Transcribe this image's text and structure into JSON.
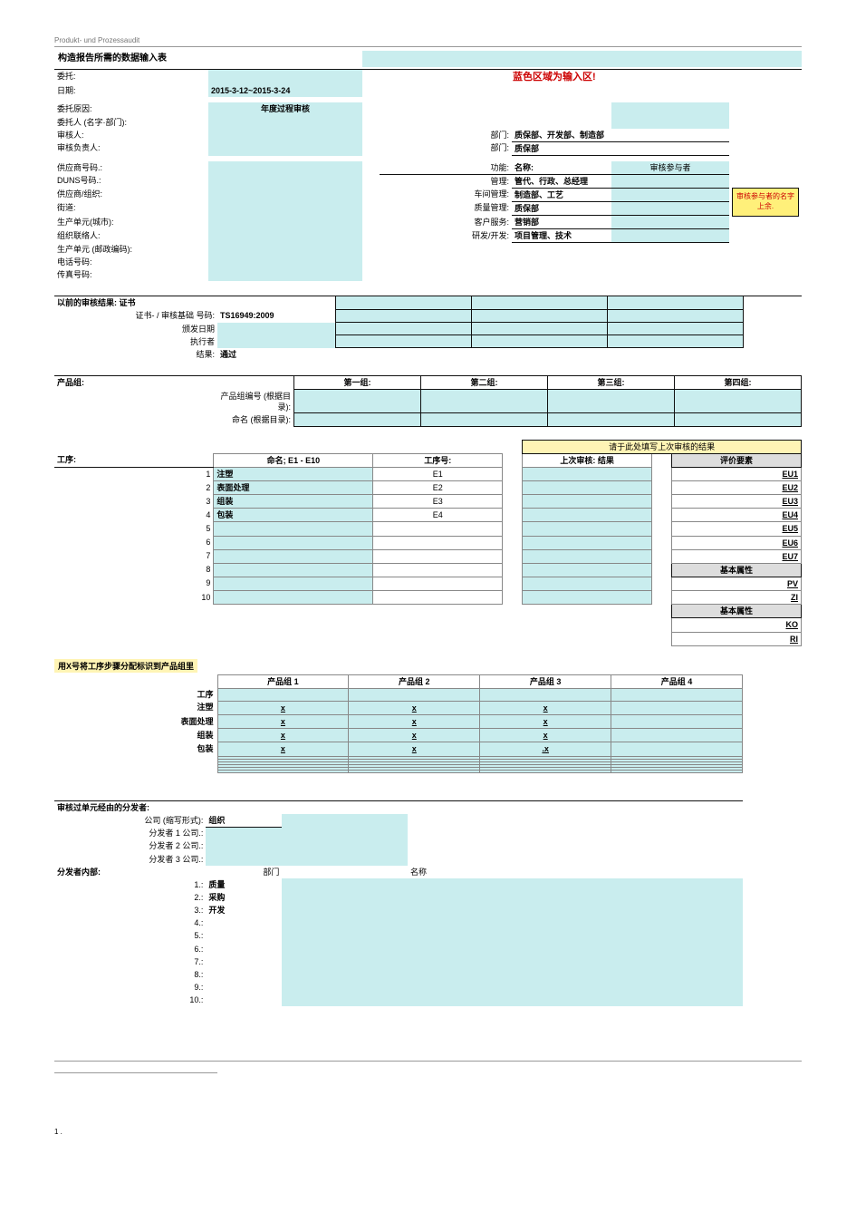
{
  "header": "Produkt- und Prozessaudit",
  "title": "构造报告所需的数据输入表",
  "note_red": "蓝色区域为输入区!",
  "info": {
    "labels": {
      "client": "委托:",
      "date": "日期:",
      "reason": "委托原因:",
      "client_person": "委托人 (名字·部门):",
      "auditor": "审核人:",
      "supervisor": "审核负责人:",
      "supplier_no": "供应商号码.:",
      "duns": "DUNS号码.:",
      "supplier_org": "供应商/组织:",
      "street": "街道:",
      "prod_unit_city": "生产单元(城市):",
      "org_contact": "组织联络人:",
      "prod_unit_zip": "生产单元 (邮政编码):",
      "tel": "电话号码:",
      "fax": "传真号码:"
    },
    "date_value": "2015-3-12~2015-3-24",
    "reason_value": "年度过程审核",
    "dept_lab": "部门:",
    "dept_val_1": "质保部、开发部、制造部",
    "dept_val_2": "质保部",
    "func_lab": "功能:",
    "name_lab": "名称:",
    "participants_lab": "审核参与者",
    "mgmt_lab": "管理:",
    "mgmt_val": "管代、行政、总经理",
    "shop_lab": "车间管理:",
    "shop_val": "制造部、工艺",
    "qa_lab": "质量管理:",
    "qa_val": "质保部",
    "cs_lab": "客户服务:",
    "cs_val": "营销部",
    "rd_lab": "研发/开发:",
    "rd_val": "项目管理、技术",
    "extra_note": "审核参与者的名字上余."
  },
  "prev": {
    "title": "以前的审核结果: 证书",
    "cert_no_lab": "证书- / 审核基础 号码:",
    "cert_no_val": "TS16949:2009",
    "issue_date_lab": "颁发日期",
    "executor_lab": "执行者",
    "result_lab": "结果:",
    "result_val": "通过"
  },
  "groups": {
    "label": "产品组:",
    "row1_lab": "产品组编号 (根据目录):",
    "row2_lab": "命名 (根据目录):",
    "heads": [
      "第一组:",
      "第二组:",
      "第三组:",
      "第四组:"
    ]
  },
  "proc": {
    "label": "工序:",
    "name_lab": "命名; E1 - E10",
    "step_lab": "工序号:",
    "last_lab": "上次审核: 结果",
    "note": "请于此处填写上次审核的结果",
    "eval_head": "评价要素",
    "basic_head": "基本属性",
    "rows": [
      {
        "n": "1",
        "name": "注塑",
        "step": "E1",
        "ev": "EU1"
      },
      {
        "n": "2",
        "name": "表面处理",
        "step": "E2",
        "ev": "EU2"
      },
      {
        "n": "3",
        "name": "组装",
        "step": "E3",
        "ev": "EU3"
      },
      {
        "n": "4",
        "name": "包装",
        "step": "E4",
        "ev": "EU4"
      },
      {
        "n": "5",
        "name": "",
        "step": "",
        "ev": "EU5"
      },
      {
        "n": "6",
        "name": "",
        "step": "",
        "ev": "EU6"
      },
      {
        "n": "7",
        "name": "",
        "step": "",
        "ev": "EU7"
      },
      {
        "n": "8",
        "name": "",
        "step": "",
        "ev": ""
      },
      {
        "n": "9",
        "name": "",
        "step": "",
        "ev": "PV"
      },
      {
        "n": "10",
        "name": "",
        "step": "",
        "ev": "ZI"
      }
    ],
    "extra_ev": [
      "KO",
      "RI"
    ]
  },
  "matrix": {
    "title": "用X号将工序步骤分配标识到产品组里",
    "heads": [
      "产品组 1",
      "产品组 2",
      "产品组 3",
      "产品组 4"
    ],
    "row_lab_0": "工序",
    "rows": [
      {
        "lab": "注塑",
        "v": [
          "x",
          "x",
          "x",
          ""
        ]
      },
      {
        "lab": "表面处理",
        "v": [
          "x",
          "x",
          "x",
          ""
        ]
      },
      {
        "lab": "组装",
        "v": [
          "x",
          "x",
          "x",
          ""
        ]
      },
      {
        "lab": "包装",
        "v": [
          "x",
          "x",
          ".x",
          ""
        ]
      }
    ],
    "blank_rows": 6
  },
  "dist": {
    "title": "审核过单元经由的分发者:",
    "abbr_lab": "公司 (缩写形式):",
    "abbr_val": "组织",
    "d1": "分发者 1 公司.:",
    "d2": "分发者 2 公司.:",
    "d3": "分发者 3 公司.:",
    "internal_title": "分发者内部:",
    "dept_lab": "部门",
    "name_lab": "名称",
    "rows": [
      {
        "n": "1.",
        "v": "质量"
      },
      {
        "n": "2.",
        "v": "采购"
      },
      {
        "n": "3.",
        "v": "开发"
      },
      {
        "n": "4.",
        "v": ""
      },
      {
        "n": "5.",
        "v": ""
      },
      {
        "n": "6.",
        "v": ""
      },
      {
        "n": "7.",
        "v": ""
      },
      {
        "n": "8.",
        "v": ""
      },
      {
        "n": "9.",
        "v": ""
      },
      {
        "n": "10.",
        "v": ""
      }
    ]
  },
  "footer": "1 ."
}
